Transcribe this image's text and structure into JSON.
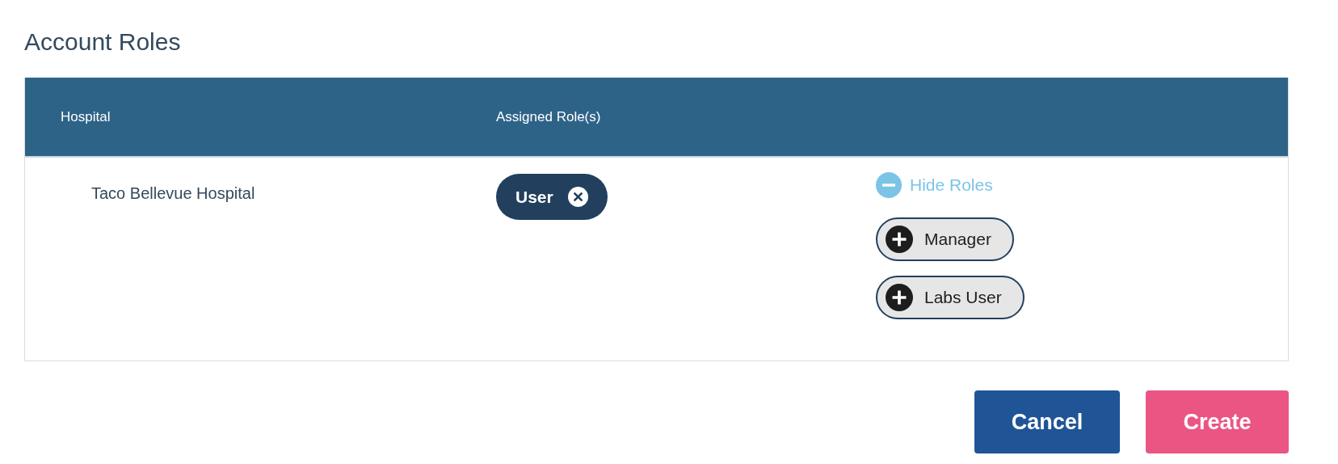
{
  "title": "Account Roles",
  "table": {
    "columns": [
      "Hospital",
      "Assigned Role(s)"
    ],
    "rows": [
      {
        "hospital": "Taco Bellevue Hospital",
        "assigned_roles": [
          {
            "label": "User"
          }
        ],
        "toggle": {
          "label": "Hide Roles",
          "expanded": true
        },
        "available_roles": [
          {
            "label": "Manager"
          },
          {
            "label": "Labs User"
          }
        ]
      }
    ]
  },
  "buttons": [
    {
      "label": "Cancel",
      "kind": "secondary"
    },
    {
      "label": "Create",
      "kind": "primary"
    }
  ]
}
